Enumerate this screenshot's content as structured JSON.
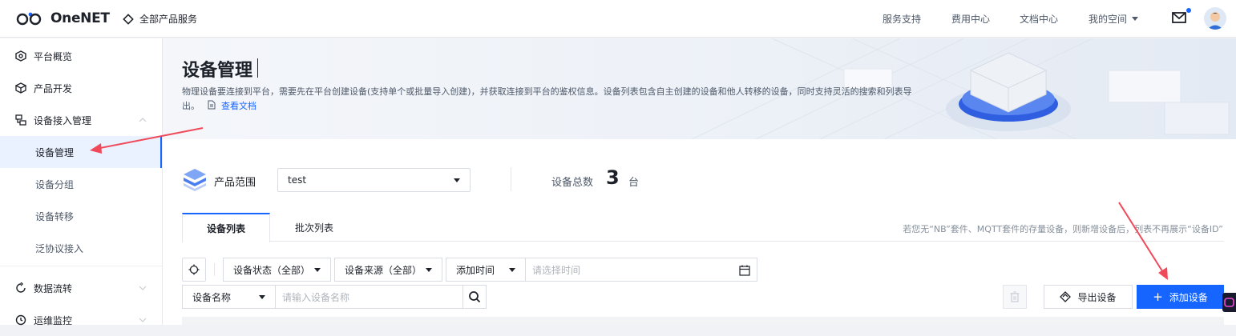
{
  "topbar": {
    "logo_text": "OneNET",
    "all_products": "全部产品服务",
    "links": [
      "服务支持",
      "费用中心",
      "文档中心"
    ],
    "my_space": "我的空间"
  },
  "sidebar": {
    "items": [
      {
        "label": "平台概览",
        "icon": "platform-icon"
      },
      {
        "label": "产品开发",
        "icon": "cube-icon"
      },
      {
        "label": "设备接入管理",
        "icon": "device-access-icon"
      }
    ],
    "sub_items": [
      {
        "label": "设备管理",
        "active": true
      },
      {
        "label": "设备分组",
        "active": false
      },
      {
        "label": "设备转移",
        "active": false
      },
      {
        "label": "泛协议接入",
        "active": false
      }
    ],
    "items_after": [
      {
        "label": "数据流转",
        "icon": "dataflow-icon"
      },
      {
        "label": "运维监控",
        "icon": "monitor-icon"
      }
    ]
  },
  "banner": {
    "title": "设备管理",
    "description": "物理设备要连接到平台，需要先在平台创建设备(支持单个或批量导入创建)，并获取连接到平台的鉴权信息。设备列表包含自主创建的设备和他人转移的设备，同时支持灵活的搜索和列表导出。",
    "doc_link": "查看文档"
  },
  "scope": {
    "label": "产品范围",
    "selected": "test",
    "total_label": "设备总数",
    "total_value": "3",
    "total_unit": "台"
  },
  "tabs": [
    "设备列表",
    "批次列表"
  ],
  "tip": "若您无“NB”套件、MQTT套件的存量设备，则新增设备后，列表不再展示“设备ID”",
  "filters": {
    "status": "设备状态（全部）",
    "source": "设备来源（全部）",
    "time_label": "添加时间",
    "time_placeholder": "请选择时间",
    "name_label": "设备名称",
    "name_placeholder": "请输入设备名称"
  },
  "actions": {
    "export": "导出设备",
    "add": "添加设备"
  },
  "colors": {
    "primary": "#1665ff",
    "annotation_arrow": "#f04a5a"
  }
}
